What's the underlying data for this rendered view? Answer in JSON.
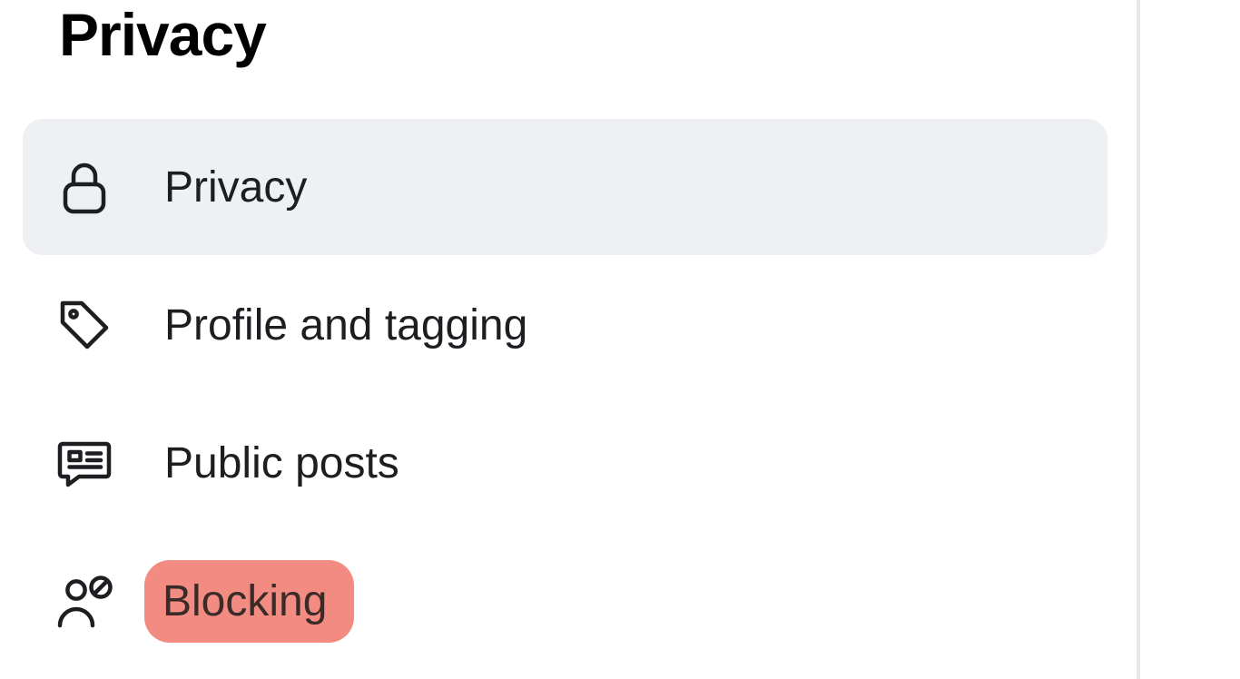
{
  "sidebar": {
    "section_title": "Privacy",
    "items": [
      {
        "label": "Privacy",
        "icon": "lock-icon",
        "selected": true,
        "highlighted": false
      },
      {
        "label": "Profile and tagging",
        "icon": "tag-icon",
        "selected": false,
        "highlighted": false
      },
      {
        "label": "Public posts",
        "icon": "posts-icon",
        "selected": false,
        "highlighted": false
      },
      {
        "label": "Blocking",
        "icon": "block-user-icon",
        "selected": false,
        "highlighted": true
      }
    ]
  }
}
